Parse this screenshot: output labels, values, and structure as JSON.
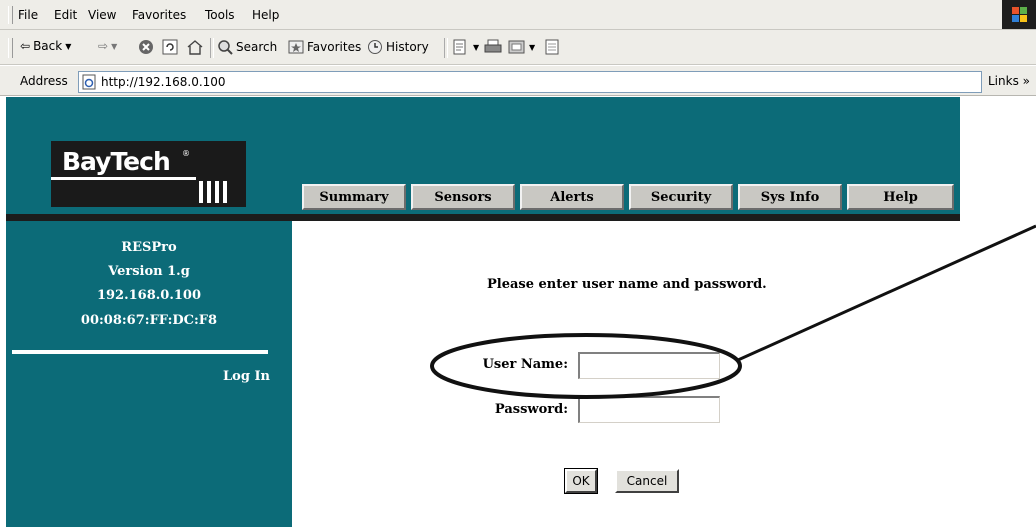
{
  "browser": {
    "menu": [
      "File",
      "Edit",
      "View",
      "Favorites",
      "Tools",
      "Help"
    ],
    "toolbar": {
      "back": "Back",
      "search": "Search",
      "favorites": "Favorites",
      "history": "History"
    },
    "address_label": "Address",
    "url": "http://192.168.0.100",
    "links_label": "Links »"
  },
  "logo": {
    "text": "BayTech",
    "reg": "®"
  },
  "nav": [
    "Summary",
    "Sensors",
    "Alerts",
    "Security",
    "Sys Info",
    "Help"
  ],
  "sidebar": {
    "product": "RESPro",
    "version": "Version 1.g",
    "ip": "192.168.0.100",
    "mac": "00:08:67:FF:DC:F8",
    "login": "Log In"
  },
  "login_form": {
    "prompt": "Please enter user name and password.",
    "username_label": "User Name:",
    "username_value": "",
    "password_label": "Password:",
    "password_value": "",
    "ok": "OK",
    "cancel": "Cancel"
  },
  "colors": {
    "page_teal": "#0c6b78",
    "chrome": "#eeede8",
    "nav_button": "#c9c8c3"
  },
  "icons": [
    "back-arrow-icon",
    "forward-arrow-icon",
    "stop-icon",
    "refresh-icon",
    "home-icon",
    "search-icon",
    "favorites-icon",
    "history-icon",
    "edit-icon",
    "print-icon",
    "mail-icon",
    "page-icon",
    "ie-page-icon",
    "windows-logo-icon"
  ]
}
